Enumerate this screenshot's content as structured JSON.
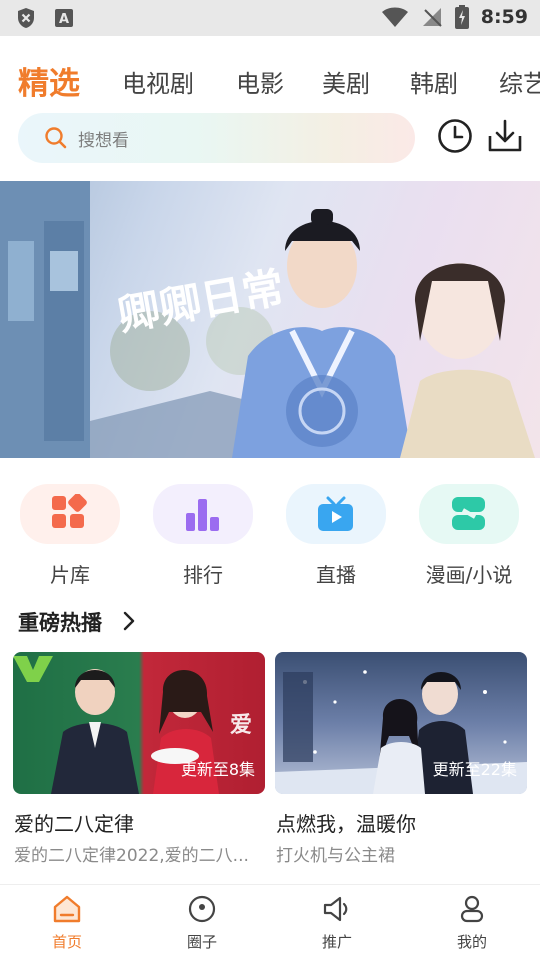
{
  "status_bar": {
    "time": "8:59"
  },
  "top_tabs": [
    "精选",
    "电视剧",
    "电影",
    "美剧",
    "韩剧",
    "综艺"
  ],
  "search": {
    "placeholder": "搜想看"
  },
  "banner": {
    "title_art": "卿卿日常"
  },
  "quick_entries": [
    {
      "label": "片库",
      "icon": "library-icon",
      "color": "#f46a4c"
    },
    {
      "label": "排行",
      "icon": "ranking-icon",
      "color": "#9b6cf0"
    },
    {
      "label": "直播",
      "icon": "live-tv-icon",
      "color": "#39a6f0"
    },
    {
      "label": "漫画/小说",
      "icon": "comic-novel-icon",
      "color": "#2dc9a7"
    }
  ],
  "section": {
    "title": "重磅热播"
  },
  "cards": [
    {
      "title": "爱的二八定律",
      "subtitle": "爱的二八定律2022,爱的二八...",
      "episode": "更新至8集"
    },
    {
      "title": "点燃我，温暖你",
      "subtitle": "打火机与公主裙",
      "episode": "更新至22集"
    }
  ],
  "bottom_nav": [
    {
      "label": "首页",
      "icon": "home-icon",
      "active": true
    },
    {
      "label": "圈子",
      "icon": "circle-icon",
      "active": false
    },
    {
      "label": "推广",
      "icon": "megaphone-icon",
      "active": false
    },
    {
      "label": "我的",
      "icon": "profile-icon",
      "active": false
    }
  ],
  "accent_color": "#f07c2c"
}
